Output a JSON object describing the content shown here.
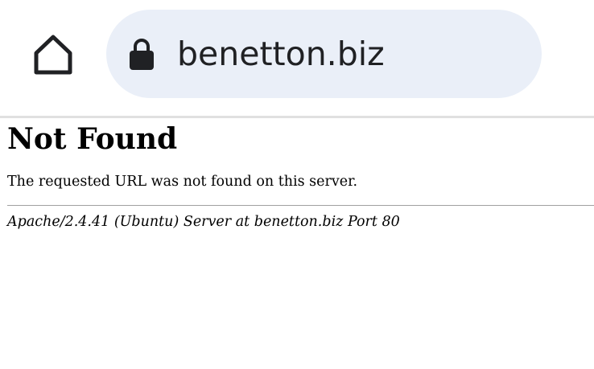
{
  "toolbar": {
    "home_icon": "home-icon",
    "lock_icon": "lock-icon",
    "url": "benetton.biz"
  },
  "page": {
    "heading": "Not Found",
    "message": "The requested URL was not found on this server.",
    "server_signature": "Apache/2.4.41 (Ubuntu) Server at benetton.biz Port 80"
  },
  "colors": {
    "omnibox_bg": "#eaeff8",
    "text": "#202124",
    "divider": "#e0e0e0"
  }
}
